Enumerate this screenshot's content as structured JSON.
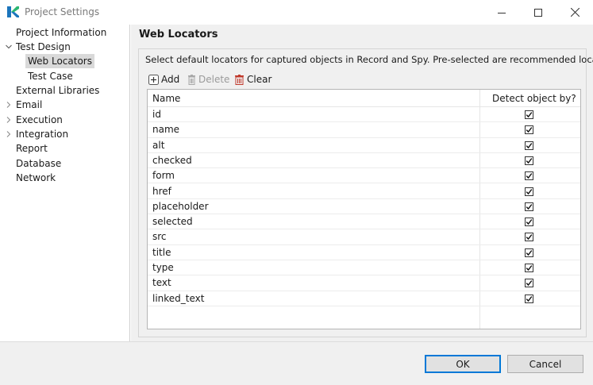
{
  "window": {
    "title": "Project Settings"
  },
  "tree": {
    "items": [
      {
        "label": "Project Information"
      },
      {
        "label": "Test Design"
      },
      {
        "label": "Web Locators"
      },
      {
        "label": "Test Case"
      },
      {
        "label": "External Libraries"
      },
      {
        "label": "Email"
      },
      {
        "label": "Execution"
      },
      {
        "label": "Integration"
      },
      {
        "label": "Report"
      },
      {
        "label": "Database"
      },
      {
        "label": "Network"
      }
    ],
    "selected": "Web Locators"
  },
  "page": {
    "title": "Web Locators",
    "description": "Select default locators for captured objects in Record and Spy. Pre-selected are recommended locators."
  },
  "toolbar": {
    "add_label": "Add",
    "delete_label": "Delete",
    "clear_label": "Clear"
  },
  "table": {
    "columns": [
      "Name",
      "Detect object by?"
    ],
    "rows": [
      {
        "name": "id",
        "checked": true
      },
      {
        "name": "name",
        "checked": true
      },
      {
        "name": "alt",
        "checked": true
      },
      {
        "name": "checked",
        "checked": true
      },
      {
        "name": "form",
        "checked": true
      },
      {
        "name": "href",
        "checked": true
      },
      {
        "name": "placeholder",
        "checked": true
      },
      {
        "name": "selected",
        "checked": true
      },
      {
        "name": "src",
        "checked": true
      },
      {
        "name": "title",
        "checked": true
      },
      {
        "name": "type",
        "checked": true
      },
      {
        "name": "text",
        "checked": true
      },
      {
        "name": "linked_text",
        "checked": true
      }
    ]
  },
  "footer": {
    "ok_label": "OK",
    "cancel_label": "Cancel"
  },
  "colors": {
    "accent": "#0078d7",
    "logo_green": "#2bb673",
    "logo_blue": "#1b75bc",
    "delete_red": "#c0392b"
  }
}
